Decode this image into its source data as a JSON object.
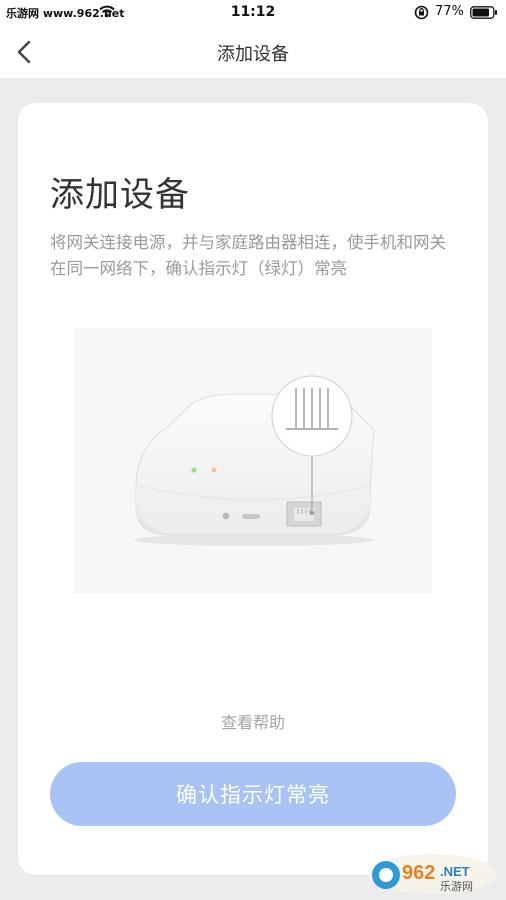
{
  "status_bar": {
    "carrier": "乐游网 www.962.net",
    "time": "11:12",
    "battery": "77%"
  },
  "nav": {
    "title": "添加设备"
  },
  "card": {
    "title": "添加设备",
    "description": "将网关连接电源，并与家庭路由器相连，使手机和网关在同一网络下，确认指示灯（绿灯）常亮",
    "help_link": "查看帮助",
    "confirm_button": "确认指示灯常亮"
  },
  "watermark": {
    "logo": "962.NET",
    "sub": "乐游网"
  },
  "colors": {
    "accent": "#a8c3f4",
    "led_green": "#9be07a",
    "led_orange": "#f2c59a"
  }
}
